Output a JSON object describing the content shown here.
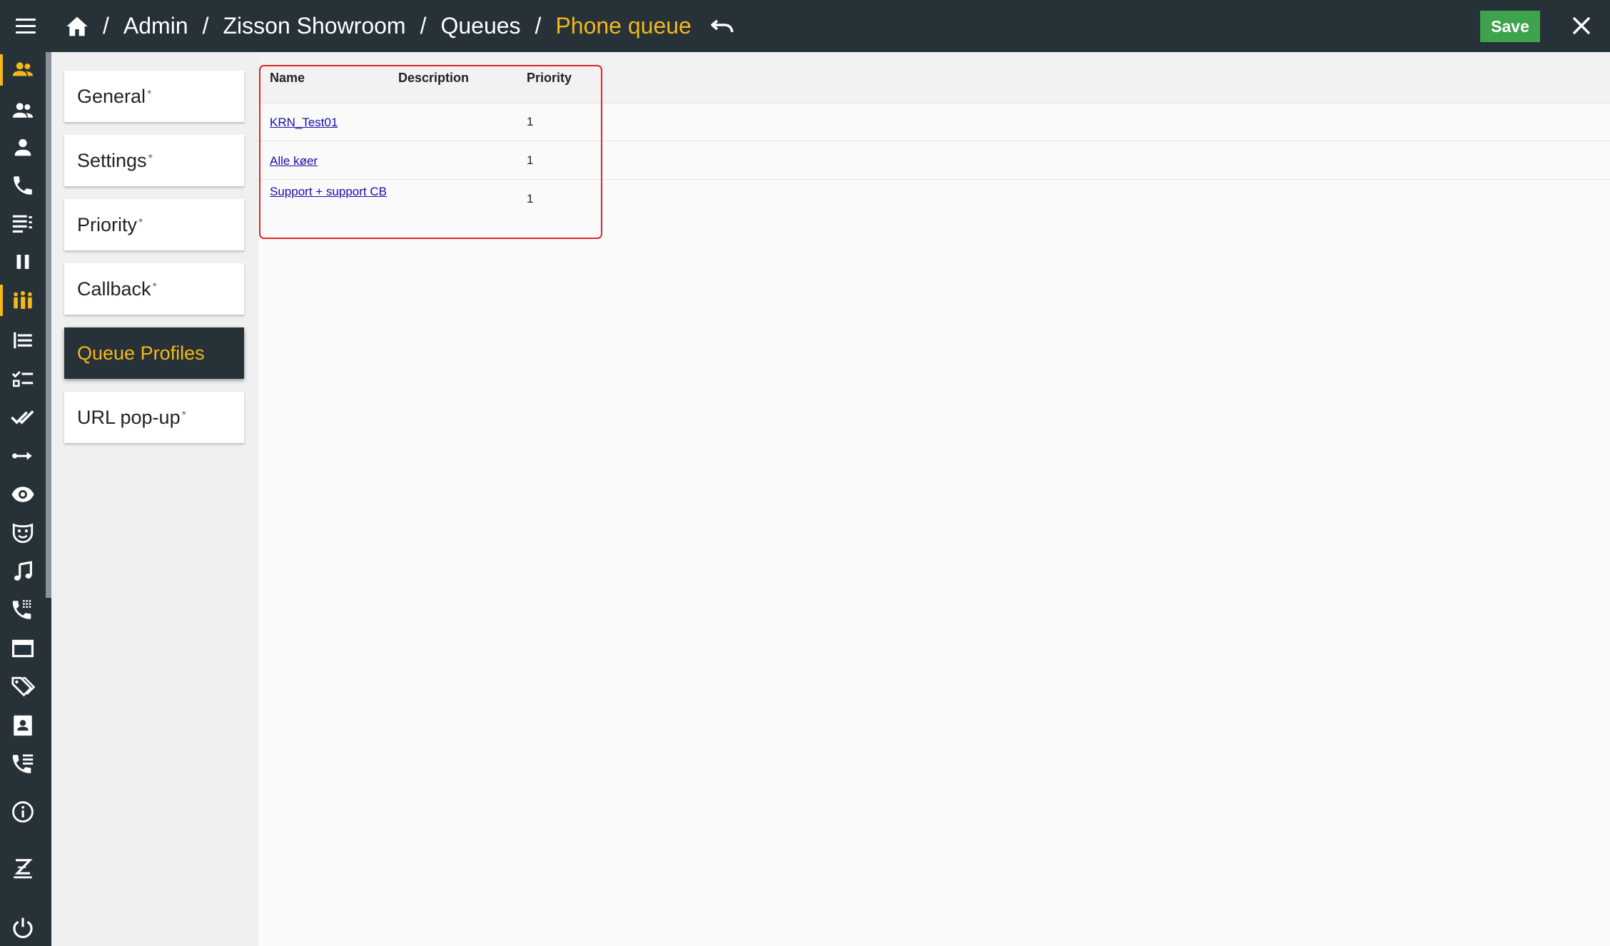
{
  "header": {
    "breadcrumbs": [
      "Admin",
      "Zisson Showroom",
      "Queues",
      "Phone queue"
    ],
    "separator": "/",
    "save_label": "Save"
  },
  "rail": {
    "items": [
      {
        "icon": "supervisor-icon",
        "active": true
      },
      {
        "icon": "people-icon"
      },
      {
        "icon": "person-icon"
      },
      {
        "icon": "phone-icon"
      },
      {
        "icon": "queue-list-icon"
      },
      {
        "icon": "pause-icon"
      },
      {
        "icon": "team-icon",
        "active": true
      },
      {
        "icon": "list-view-icon"
      },
      {
        "icon": "checklist-icon"
      },
      {
        "icon": "double-check-icon"
      },
      {
        "icon": "route-arrow-icon"
      },
      {
        "icon": "eye-icon"
      },
      {
        "icon": "mask-icon"
      },
      {
        "icon": "music-note-icon"
      },
      {
        "icon": "phone-dialpad-icon"
      },
      {
        "icon": "folder-icon"
      },
      {
        "icon": "tags-icon"
      },
      {
        "icon": "contact-card-icon"
      },
      {
        "icon": "phone-forward-icon"
      },
      {
        "icon": "info-icon"
      },
      {
        "icon": "zisson-logo-icon"
      },
      {
        "icon": "power-icon"
      }
    ]
  },
  "nav": {
    "items": [
      {
        "label": "General",
        "marker": "*"
      },
      {
        "label": "Settings",
        "marker": "*"
      },
      {
        "label": "Priority",
        "marker": "*"
      },
      {
        "label": "Callback",
        "marker": "*"
      },
      {
        "label": "Queue Profiles",
        "marker": ""
      },
      {
        "label": "URL pop-up",
        "marker": "*"
      }
    ],
    "active": "Queue Profiles"
  },
  "table": {
    "columns": [
      "Name",
      "Description",
      "Priority"
    ],
    "rows": [
      {
        "name": "KRN_Test01",
        "description": "",
        "priority": "1"
      },
      {
        "name": "Alle køer",
        "description": "",
        "priority": "1"
      },
      {
        "name": "Support + support CB",
        "description": "",
        "priority": "1"
      }
    ]
  },
  "colors": {
    "topbar": "#263238",
    "accent": "#f5b71a",
    "save": "#3fa34d",
    "highlight": "#e0242b",
    "link": "#1a0dab"
  }
}
